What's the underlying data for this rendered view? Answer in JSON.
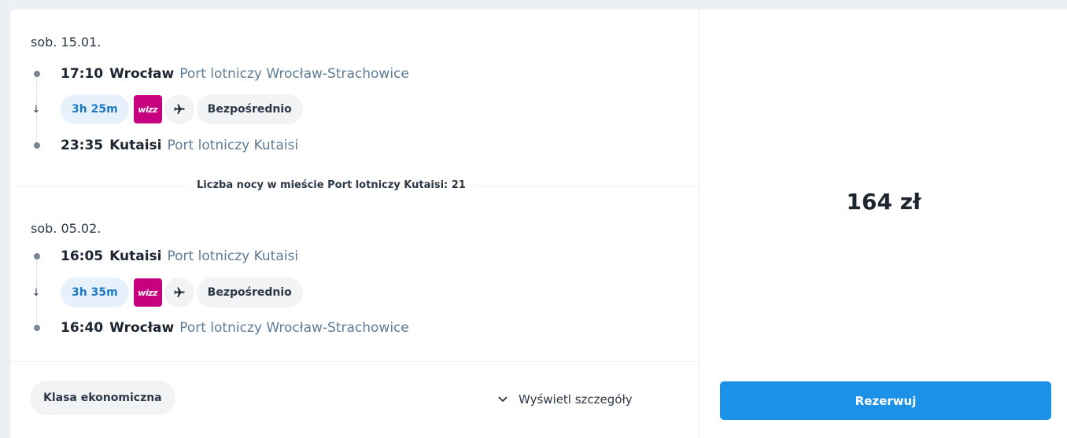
{
  "outbound": {
    "date": "sob. 15.01.",
    "departure": {
      "time": "17:10",
      "city": "Wrocław",
      "airport": "Port lotniczy Wrocław-Strachowice"
    },
    "duration": "3h 25m",
    "airline_logo_text": "wizz",
    "stops_label": "Bezpośrednio",
    "arrival": {
      "time": "23:35",
      "city": "Kutaisi",
      "airport": "Port lotniczy Kutaisi"
    }
  },
  "nights_text": "Liczba nocy w mieście Port lotniczy Kutaisi: 21",
  "inbound": {
    "date": "sob. 05.02.",
    "departure": {
      "time": "16:05",
      "city": "Kutaisi",
      "airport": "Port lotniczy Kutaisi"
    },
    "duration": "3h 35m",
    "airline_logo_text": "wizz",
    "stops_label": "Bezpośrednio",
    "arrival": {
      "time": "16:40",
      "city": "Wrocław",
      "airport": "Port lotniczy Wrocław-Strachowice"
    }
  },
  "cabin_class": "Klasa ekonomiczna",
  "details_label": "Wyświetl szczegóły",
  "price": "164 zł",
  "book_label": "Rezerwuj",
  "icons": {
    "plane": "plane-icon",
    "arrow": "arrow-down-icon",
    "chevron": "chevron-down-icon",
    "stop_dot": "stop-dot-icon"
  },
  "colors": {
    "accent": "#1b91e8",
    "airline_brand": "#c6007e",
    "airport_text": "#5f7c96",
    "duration_text": "#1e79c4",
    "duration_bg": "#e6f1fb"
  }
}
